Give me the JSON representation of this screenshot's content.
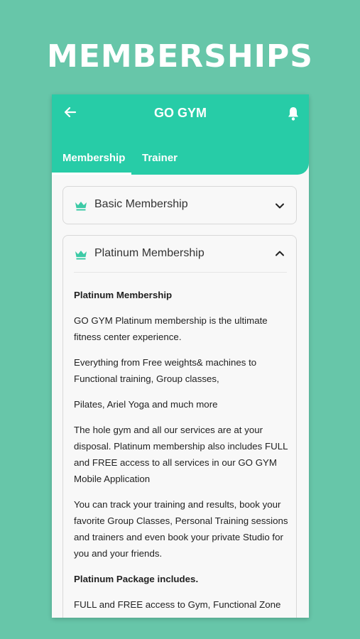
{
  "promo": {
    "title": "MEMBERSHIPS"
  },
  "appbar": {
    "title": "GO GYM",
    "back_icon": "arrow-left-icon",
    "bell_icon": "bell-icon",
    "color": "#27cca7"
  },
  "tabs": [
    {
      "label": "Membership",
      "active": true
    },
    {
      "label": "Trainer",
      "active": false
    }
  ],
  "memberships": [
    {
      "label": "Basic Membership",
      "icon": "crown-icon",
      "expanded": false,
      "chevron": "chevron-down-icon"
    },
    {
      "label": "Platinum Membership",
      "icon": "crown-icon",
      "expanded": true,
      "chevron": "chevron-up-icon",
      "content": {
        "heading": "Platinum Membership",
        "p1": "GO GYM Platinum membership is the ultimate fitness center experience.",
        "p2": "Everything from Free weights& machines to Functional training, Group classes,",
        "p3": "Pilates, Ariel Yoga and much more",
        "p4": "The hole gym and all our services are at your disposal. Platinum membership also includes FULL and FREE access to all services in our GO GYM Mobile Application",
        "p5": "You can track your training and results, book your favorite Group Classes, Personal Training sessions and trainers and even book your private Studio for you and your friends.",
        "package_heading": "Platinum Package includes.",
        "p6": "FULL and FREE access to Gym, Functional Zone"
      }
    }
  ],
  "colors": {
    "background": "#67c6a9",
    "accent": "#27cca7",
    "icon": "#3ccaa6"
  }
}
